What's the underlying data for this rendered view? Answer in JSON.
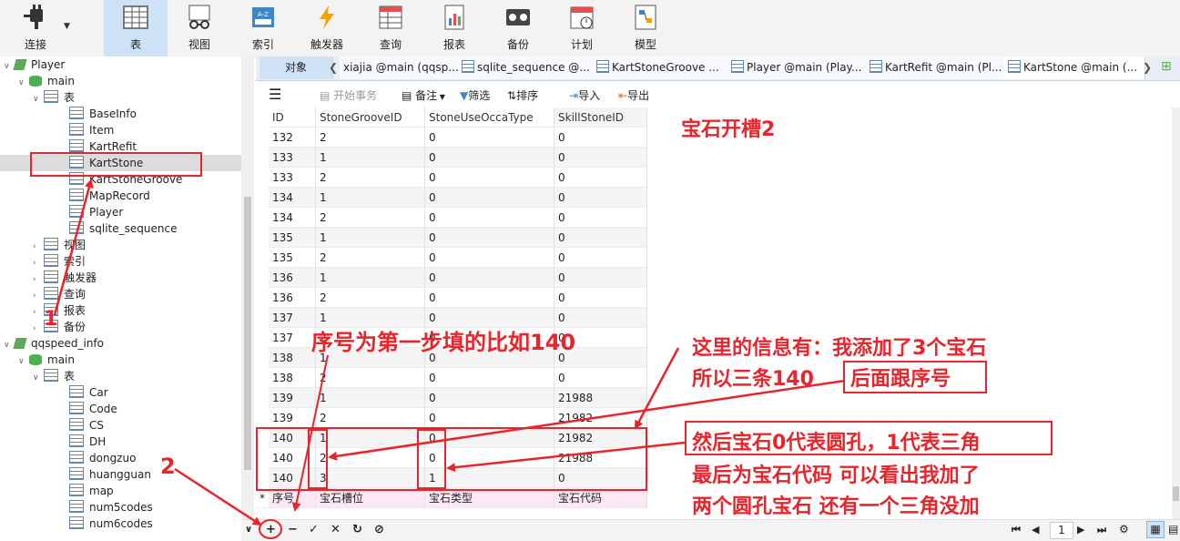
{
  "toolbar": {
    "items": [
      {
        "label": "连接",
        "icon": "plug-icon"
      },
      {
        "label": "表",
        "icon": "table-icon"
      },
      {
        "label": "视图",
        "icon": "view-icon"
      },
      {
        "label": "索引",
        "icon": "index-icon"
      },
      {
        "label": "触发器",
        "icon": "trigger-icon"
      },
      {
        "label": "查询",
        "icon": "query-icon"
      },
      {
        "label": "报表",
        "icon": "report-icon"
      },
      {
        "label": "备份",
        "icon": "backup-icon"
      },
      {
        "label": "计划",
        "icon": "schedule-icon"
      },
      {
        "label": "模型",
        "icon": "model-icon"
      }
    ]
  },
  "sidebar": {
    "db1": "Player",
    "schema1": "main",
    "tables_label": "表",
    "tables1": [
      "BaseInfo",
      "Item",
      "KartRefit",
      "KartStone",
      "KartStoneGroove",
      "MapRecord",
      "Player",
      "sqlite_sequence"
    ],
    "groups": [
      "视图",
      "索引",
      "触发器",
      "查询",
      "报表",
      "备份"
    ],
    "db2": "qqspeed_info",
    "schema2": "main",
    "tables2": [
      "Car",
      "Code",
      "CS",
      "DH",
      "dongzuo",
      "huangguan",
      "map",
      "num5codes",
      "num6codes"
    ]
  },
  "tabs": [
    "对象",
    "xiajia @main (qqsp...",
    "sqlite_sequence @...",
    "KartStoneGroove ...",
    "Player @main (Play...",
    "KartRefit @main (Pl...",
    "KartStone @main (..."
  ],
  "datatoolbar": {
    "begin": "开始事务",
    "note": "备注",
    "filter": "筛选",
    "sort": "排序",
    "import": "导入",
    "export": "导出"
  },
  "grid": {
    "headers": [
      "ID",
      "StoneGrooveID",
      "StoneUseOccaType",
      "SkillStoneID"
    ],
    "rows": [
      [
        "132",
        "2",
        "0",
        "0"
      ],
      [
        "133",
        "1",
        "0",
        "0"
      ],
      [
        "133",
        "2",
        "0",
        "0"
      ],
      [
        "134",
        "1",
        "0",
        "0"
      ],
      [
        "134",
        "2",
        "0",
        "0"
      ],
      [
        "135",
        "1",
        "0",
        "0"
      ],
      [
        "135",
        "2",
        "0",
        "0"
      ],
      [
        "136",
        "1",
        "0",
        "0"
      ],
      [
        "136",
        "2",
        "0",
        "0"
      ],
      [
        "137",
        "1",
        "0",
        "0"
      ],
      [
        "137",
        "2",
        "0",
        "0"
      ],
      [
        "138",
        "1",
        "0",
        "0"
      ],
      [
        "138",
        "2",
        "0",
        "0"
      ],
      [
        "139",
        "1",
        "0",
        "21988"
      ],
      [
        "139",
        "2",
        "0",
        "21982"
      ],
      [
        "140",
        "1",
        "0",
        "21982"
      ],
      [
        "140",
        "2",
        "0",
        "21988"
      ],
      [
        "140",
        "3",
        "1",
        "0"
      ]
    ],
    "new_row_marker": "*",
    "new_row": [
      "序号",
      "宝石槽位",
      "宝石类型",
      "宝石代码"
    ]
  },
  "bottom": {
    "page": "1"
  },
  "annotations": {
    "title": "宝石开槽2",
    "num1": "1",
    "num2": "2",
    "seq": "序号为第一步填的比如140",
    "info1": "这里的信息有：我添加了3个宝石",
    "info2a": "所以三条140",
    "info2b": "后面跟序号",
    "gem1": "然后宝石0代表圆孔，1代表三角",
    "gem2": "最后为宝石代码  可以看出我加了",
    "gem3": "两个圆孔宝石  还有一个三角没加"
  },
  "colors": {
    "accent": "#e8242c",
    "toolbar_active": "#cde3f5",
    "new_row": "#fbe8f4"
  }
}
